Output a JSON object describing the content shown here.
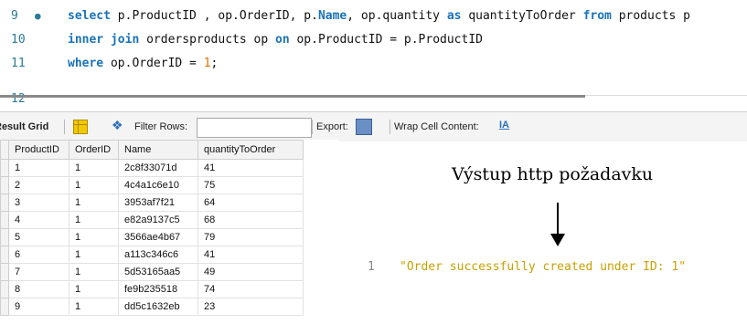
{
  "editor": {
    "lines": [
      {
        "number": "9",
        "marker": "●",
        "tokens": [
          {
            "t": "select",
            "c": "kw"
          },
          {
            "t": " p.ProductID , op.OrderID, p.",
            "c": ""
          },
          {
            "t": "Name",
            "c": "fn"
          },
          {
            "t": ", op.quantity ",
            "c": ""
          },
          {
            "t": "as",
            "c": "kw"
          },
          {
            "t": " quantityToOrder ",
            "c": ""
          },
          {
            "t": "from",
            "c": "kw"
          },
          {
            "t": " products p",
            "c": ""
          }
        ]
      },
      {
        "number": "10",
        "marker": "",
        "tokens": [
          {
            "t": "inner join",
            "c": "kw"
          },
          {
            "t": " ordersproducts op ",
            "c": ""
          },
          {
            "t": "on",
            "c": "kw"
          },
          {
            "t": " op.ProductID = p.ProductID",
            "c": ""
          }
        ]
      },
      {
        "number": "11",
        "marker": "",
        "tokens": [
          {
            "t": "where",
            "c": "kw"
          },
          {
            "t": " op.OrderID = ",
            "c": ""
          },
          {
            "t": "1",
            "c": "num"
          },
          {
            "t": ";",
            "c": ""
          }
        ]
      },
      {
        "number": "12",
        "marker": "",
        "tokens": []
      }
    ]
  },
  "toolbar": {
    "result_grid_label": "Result Grid",
    "filter_rows_label": "Filter Rows:",
    "filter_value": "",
    "export_label": "Export:",
    "wrap_label": "Wrap Cell Content:",
    "wrap_icon": "IA"
  },
  "grid": {
    "columns": [
      "ProductID",
      "OrderID",
      "Name",
      "quantityToOrder"
    ],
    "rows": [
      [
        "1",
        "1",
        "2c8f33071d",
        "41"
      ],
      [
        "2",
        "1",
        "4c4a1c6e10",
        "75"
      ],
      [
        "3",
        "1",
        "3953af7f21",
        "64"
      ],
      [
        "4",
        "1",
        "e82a9137c5",
        "68"
      ],
      [
        "5",
        "1",
        "3566ae4b67",
        "79"
      ],
      [
        "6",
        "1",
        "a113c346c6",
        "41"
      ],
      [
        "7",
        "1",
        "5d53165aa5",
        "49"
      ],
      [
        "8",
        "1",
        "fe9b235518",
        "74"
      ],
      [
        "9",
        "1",
        "dd5c1632eb",
        "23"
      ]
    ]
  },
  "annotation": {
    "title": "Výstup http požadavku"
  },
  "response": {
    "line_number": "1",
    "text": "\"Order successfully created under ID: 1\""
  }
}
